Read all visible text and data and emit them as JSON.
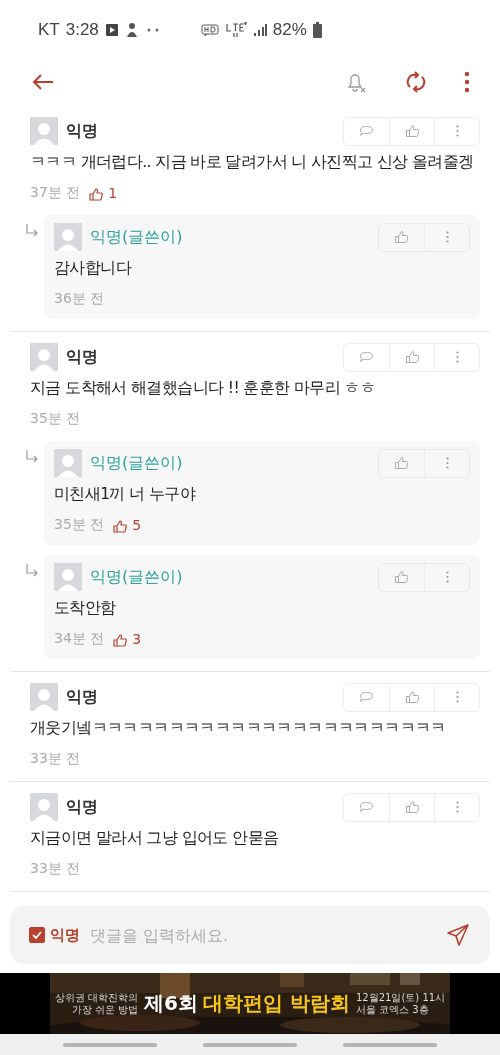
{
  "status_bar": {
    "carrier": "KT",
    "time": "3:28",
    "battery": "82%"
  },
  "comments": [
    {
      "author": "익명",
      "is_writer": false,
      "text": "ㅋㅋㅋ 개더럽다.. 지금 바로 달려가서 니 사진찍고 신상 올려줄겡",
      "time": "37분 전",
      "likes": "1",
      "children": [
        {
          "author": "익명(글쓴이)",
          "is_writer": true,
          "text": "감사합니다",
          "time": "36분 전"
        }
      ]
    },
    {
      "author": "익명",
      "is_writer": false,
      "text": "지금 도착해서 해결했습니다 !! 훈훈한 마무리 ㅎㅎ",
      "time": "35분 전",
      "children": [
        {
          "author": "익명(글쓴이)",
          "is_writer": true,
          "text": "미친새1끼 너 누구야",
          "time": "35분 전",
          "likes": "5"
        },
        {
          "author": "익명(글쓴이)",
          "is_writer": true,
          "text": "도착안함",
          "time": "34분 전",
          "likes": "3"
        }
      ]
    },
    {
      "author": "익명",
      "is_writer": false,
      "text": "개웃기넼ㅋㅋㅋㅋㅋㅋㅋㅋㅋㅋㅋㅋㅋㅋㅋㅋㅋㅋㅋㅋㅋㅋㅋ",
      "time": "33분 전"
    },
    {
      "author": "익명",
      "is_writer": false,
      "text": "지금이면 말라서 그냥 입어도 안묻음",
      "time": "33분 전"
    }
  ],
  "composer": {
    "anonymous_checked": true,
    "anonymous_label": "익명",
    "placeholder": "댓글을 입력하세요."
  },
  "banner": {
    "tagline": [
      "상위권 대학진학의",
      "가장 쉬운 방법"
    ],
    "title_lead": "제6회",
    "title": "대학편입 박람회",
    "details": [
      "12월21일(토) 11시",
      "서울 코엑스 3층"
    ]
  }
}
